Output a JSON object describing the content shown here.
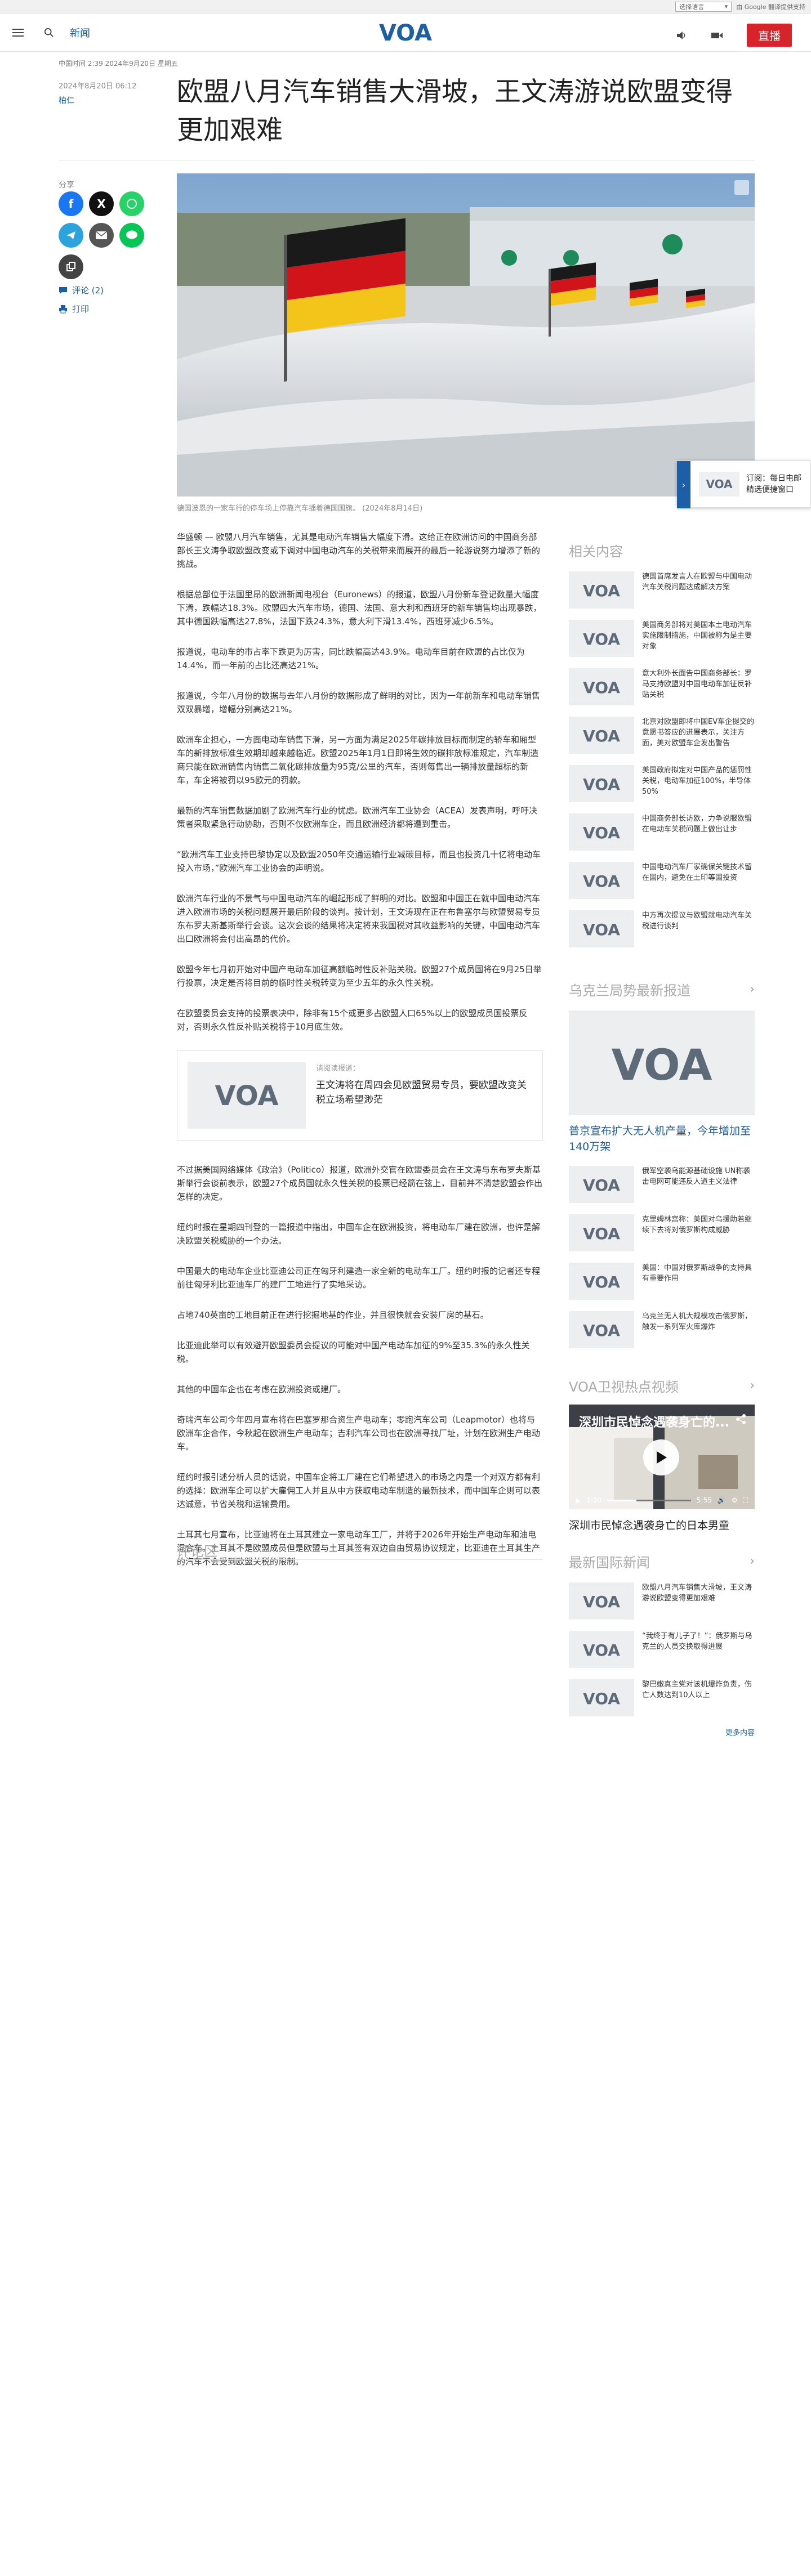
{
  "translate_bar": {
    "select_label": "选择语言",
    "powered": "由 Google 翻译提供支持"
  },
  "header": {
    "section": "新闻",
    "live_label": "直播",
    "logo_text": "VOA"
  },
  "issue_line": "中国时间 2:39 2024年9月20日 星期五",
  "article": {
    "date": "2024年8月20日 06:12",
    "author": "柏仁",
    "title": "欧盟八月汽车销售大滑坡，王文涛游说欧盟变得更加艰难",
    "share_label": "分享",
    "comment_link": "评论 (2)",
    "print_link": "打印",
    "caption": "德国波恩的一家车行的停车场上停靠汽车插着德国国旗。 (2024年8月14日)",
    "paragraphs_a": [
      "华盛顿 — 欧盟八月汽车销售，尤其是电动汽车销售大幅度下滑。这给正在欧洲访问的中国商务部部长王文涛争取欧盟改变或下调对中国电动汽车的关税带来而展开的最后一轮游说努力增添了新的挑战。",
      "根据总部位于法国里昂的欧洲新闻电视台（Euronews）的报道，欧盟八月份新车登记数量大幅度下滑，跌幅达18.3%。欧盟四大汽车市场，德国、法国、意大利和西班牙的新车销售均出现暴跌，其中德国跌幅高达27.8%，法国下跌24.3%，意大利下滑13.4%，西班牙减少6.5%。",
      "报道说，电动车的市占率下跌更为厉害，同比跌幅高达43.9%。电动车目前在欧盟的占比仅为14.4%，而一年前的占比还高达21%。",
      "报道说，今年八月份的数据与去年八月份的数据形成了鲜明的对比，因为一年前新车和电动车销售双双暴增，增幅分别高达21%。",
      "欧洲车企担心，一方面电动车销售下滑，另一方面为满足2025年碳排放目标而制定的轿车和厢型车的新排放标准生效期却越来越临近。欧盟2025年1月1日即将生效的碳排放标准规定，汽车制造商只能在欧洲销售内销售二氧化碳排放量为95克/公里的汽车，否则每售出一辆排放量超标的新车，车企将被罚以95欧元的罚款。",
      "最新的汽车销售数据加剧了欧洲汽车行业的忧虑。欧洲汽车工业协会（ACEA）发表声明，呼吁决策者采取紧急行动协助，否则不仅欧洲车企，而且欧洲经济都将遭到重击。",
      "“欧洲汽车工业支持巴黎协定以及欧盟2050年交通运输行业减碳目标，而且也投资几十亿将电动车投入市场，”欧洲汽车工业协会的声明说。",
      "欧洲汽车行业的不景气与中国电动汽车的崛起形成了鲜明的对比。欧盟和中国正在就中国电动汽车进入欧洲市场的关税问题展开最后阶段的谈判。按计划，王文涛现在正在布鲁塞尔与欧盟贸易专员东布罗夫斯基斯举行会谈。这次会谈的结果将决定将来我国税对其收益影响的关键，中国电动汽车出口欧洲将会付出高昂的代价。",
      "欧盟今年七月初开始对中国产电动车加征高额临时性反补贴关税。欧盟27个成员国将在9月25日举行投票，决定是否将目前的临时性关税转变为至少五年的永久性关税。",
      "在欧盟委员会支持的投票表决中，除非有15个或更多占欧盟人口65%以上的欧盟成员国投票反对，否则永久性反补贴关税将于10月底生效。"
    ],
    "related": {
      "kicker": "请阅读报道：",
      "title": "王文涛将在周四会见欧盟贸易专员，要欧盟改变关税立场希望渺茫"
    },
    "paragraphs_b": [
      "不过据美国网络媒体《政治》（Politico）报道，欧洲外交官在欧盟委员会在王文涛与东布罗夫斯基斯举行会谈前表示，欧盟27个成员国就永久性关税的投票已经箭在弦上，目前并不清楚欧盟会作出怎样的决定。",
      "纽约时报在星期四刊登的一篇报道中指出，中国车企在欧洲投资，将电动车厂建在欧洲，也许是解决欧盟关税威胁的一个办法。",
      "中国最大的电动车企业比亚迪公司正在匈牙利建造一家全新的电动车工厂。纽约时报的记者还专程前往匈牙利比亚迪车厂的建厂工地进行了实地采访。",
      "占地740英亩的工地目前正在进行挖掘地基的作业，并且很快就会安装厂房的基石。",
      "比亚迪此举可以有效避开欧盟委员会提议的可能对中国产电动车加征的9%至35.3%的永久性关税。",
      "其他的中国车企也在考虑在欧洲投资或建厂。",
      "奇瑞汽车公司今年四月宣布将在巴塞罗那合资生产电动车；零跑汽车公司（Leapmotor）也将与欧洲车企合作，今秋起在欧洲生产电动车；吉利汽车公司也在欧洲寻找厂址，计划在欧洲生产电动车。",
      "纽约时报引述分析人员的话说，中国车企将工厂建在它们希望进入的市场之内是一个对双方都有利的选择：欧洲车企可以扩大雇佣工人并且从中方获取电动车制造的最新技术，而中国车企则可以表达诚意，节省关税和运输费用。",
      "土耳其七月宣布，比亚迪将在土耳其建立一家电动车工厂，并将于2026年开始生产电动车和油电混合车。土耳其不是欧盟成员但是欧盟与土耳其签有双边自由贸易协议规定，比亚迪在土耳其生产的汽车不会受到欧盟关税的限制。"
    ],
    "comments_heading": "评论区"
  },
  "float_cta": {
    "text_line1": "订阅：每日电邮",
    "text_line2": "精选便捷窗口"
  },
  "sidebar": {
    "related_heading": "相关内容",
    "related_items": [
      "德国首席发言人在欧盟与中国电动汽车关税问题达成解决方案",
      "美国商务部将对美国本土电动汽车实施限制措施，中国被称为是主要对象",
      "意大利外长面告中国商务部长：罗马支持欧盟对中国电动车加征反补贴关税",
      "北京对欧盟即将中国EV车企提交的意愿书答应的进展表示，关注方面，美对欧盟车企发出警告",
      "美国政府拟定对中国产品的惩罚性关税，电动车加征100%，半导体50%",
      "中国商务部长访欧，力争说服欧盟在电动车关税问题上做出让步",
      "中国电动汽车厂家确保关键技术留在国内，避免在土印等国投资",
      "中方再次提议与欧盟就电动汽车关税进行谈判"
    ],
    "ukraine_heading": "乌克兰局势最新报道",
    "ukraine_feature": "普京宣布扩大无人机产量，今年增加至140万架",
    "ukraine_items": [
      "俄军空袭乌能源基础设施 UN称袭击电网可能违反人道主义法律",
      "克里姆林宫称：美国对乌援助若继续下去将对俄罗斯构成威胁",
      "美国：中国对俄罗斯战争的支持具有重要作用",
      "乌克兰无人机大规模攻击俄罗斯，触发一系列军火库爆炸"
    ],
    "video_heading": "VOA卫视热点视频",
    "video": {
      "overlay_title": "深圳市民悼念遇袭身亡的...",
      "time_current": "1:20",
      "time_total": "5:55",
      "progress": 0.35,
      "caption": "深圳市民悼念遇袭身亡的日本男童"
    },
    "intl_heading": "最新国际新闻",
    "intl_items": [
      "欧盟八月汽车销售大滑坡，王文涛游说欧盟变得更加艰难",
      "“我终于有儿子了！”：俄罗斯与乌克兰的人员交换取得进展",
      "黎巴嫩真主党对该机爆炸负责，伤亡人数达到10人以上"
    ],
    "more_link": "更多内容"
  },
  "colors": {
    "accent": "#1d5fa6",
    "live": "#d8232a",
    "logo": "#1d5fa6"
  }
}
